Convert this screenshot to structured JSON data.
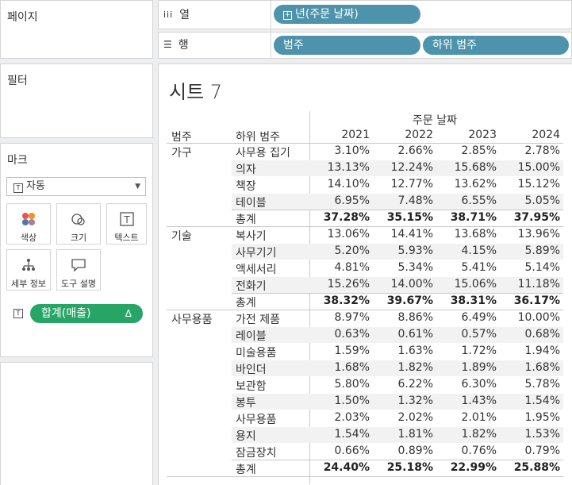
{
  "panels": {
    "pages": "페이지",
    "filters": "필터",
    "marks": "마크"
  },
  "shelves": {
    "columns_label": "열",
    "rows_label": "행",
    "columns_pill": "년(주문 날짜)",
    "rows_pills": [
      "범주",
      "하위 범주"
    ]
  },
  "marks": {
    "type": "자동",
    "buttons": [
      "색상",
      "크기",
      "텍스트",
      "세부 정보",
      "도구 설명"
    ],
    "measure": "합계(매출)",
    "measure_delta": "Δ"
  },
  "sheet": {
    "title": "시트 7",
    "header_group": "주문 날짜",
    "col_category": "범주",
    "col_subcategory": "하위 범주",
    "years": [
      "2021",
      "2022",
      "2023",
      "2024"
    ],
    "total_label": "총계",
    "groups": [
      {
        "category": "가구",
        "rows": [
          {
            "sub": "사무용 집기",
            "v": [
              "3.10%",
              "2.66%",
              "2.85%",
              "2.78%"
            ]
          },
          {
            "sub": "의자",
            "v": [
              "13.13%",
              "12.24%",
              "15.68%",
              "15.00%"
            ]
          },
          {
            "sub": "책장",
            "v": [
              "14.10%",
              "12.77%",
              "13.62%",
              "15.12%"
            ]
          },
          {
            "sub": "테이블",
            "v": [
              "6.95%",
              "7.48%",
              "6.55%",
              "5.05%"
            ]
          }
        ],
        "total": [
          "37.28%",
          "35.15%",
          "38.71%",
          "37.95%"
        ]
      },
      {
        "category": "기술",
        "rows": [
          {
            "sub": "복사기",
            "v": [
              "13.06%",
              "14.41%",
              "13.68%",
              "13.96%"
            ]
          },
          {
            "sub": "사무기기",
            "v": [
              "5.20%",
              "5.93%",
              "4.15%",
              "5.89%"
            ]
          },
          {
            "sub": "액세서리",
            "v": [
              "4.81%",
              "5.34%",
              "5.41%",
              "5.14%"
            ]
          },
          {
            "sub": "전화기",
            "v": [
              "15.26%",
              "14.00%",
              "15.06%",
              "11.18%"
            ]
          }
        ],
        "total": [
          "38.32%",
          "39.67%",
          "38.31%",
          "36.17%"
        ]
      },
      {
        "category": "사무용품",
        "rows": [
          {
            "sub": "가전 제품",
            "v": [
              "8.97%",
              "8.86%",
              "6.49%",
              "10.00%"
            ]
          },
          {
            "sub": "레이블",
            "v": [
              "0.63%",
              "0.61%",
              "0.57%",
              "0.68%"
            ]
          },
          {
            "sub": "미술용품",
            "v": [
              "1.59%",
              "1.63%",
              "1.72%",
              "1.94%"
            ]
          },
          {
            "sub": "바인더",
            "v": [
              "1.68%",
              "1.82%",
              "1.89%",
              "1.68%"
            ]
          },
          {
            "sub": "보관함",
            "v": [
              "5.80%",
              "6.22%",
              "6.30%",
              "5.78%"
            ]
          },
          {
            "sub": "봉투",
            "v": [
              "1.50%",
              "1.32%",
              "1.43%",
              "1.54%"
            ]
          },
          {
            "sub": "사무용품",
            "v": [
              "2.03%",
              "2.02%",
              "2.01%",
              "1.95%"
            ]
          },
          {
            "sub": "용지",
            "v": [
              "1.54%",
              "1.81%",
              "1.82%",
              "1.53%"
            ]
          },
          {
            "sub": "잠금장치",
            "v": [
              "0.66%",
              "0.89%",
              "0.76%",
              "0.79%"
            ]
          }
        ],
        "total": [
          "24.40%",
          "25.18%",
          "22.99%",
          "25.88%"
        ]
      }
    ]
  }
}
